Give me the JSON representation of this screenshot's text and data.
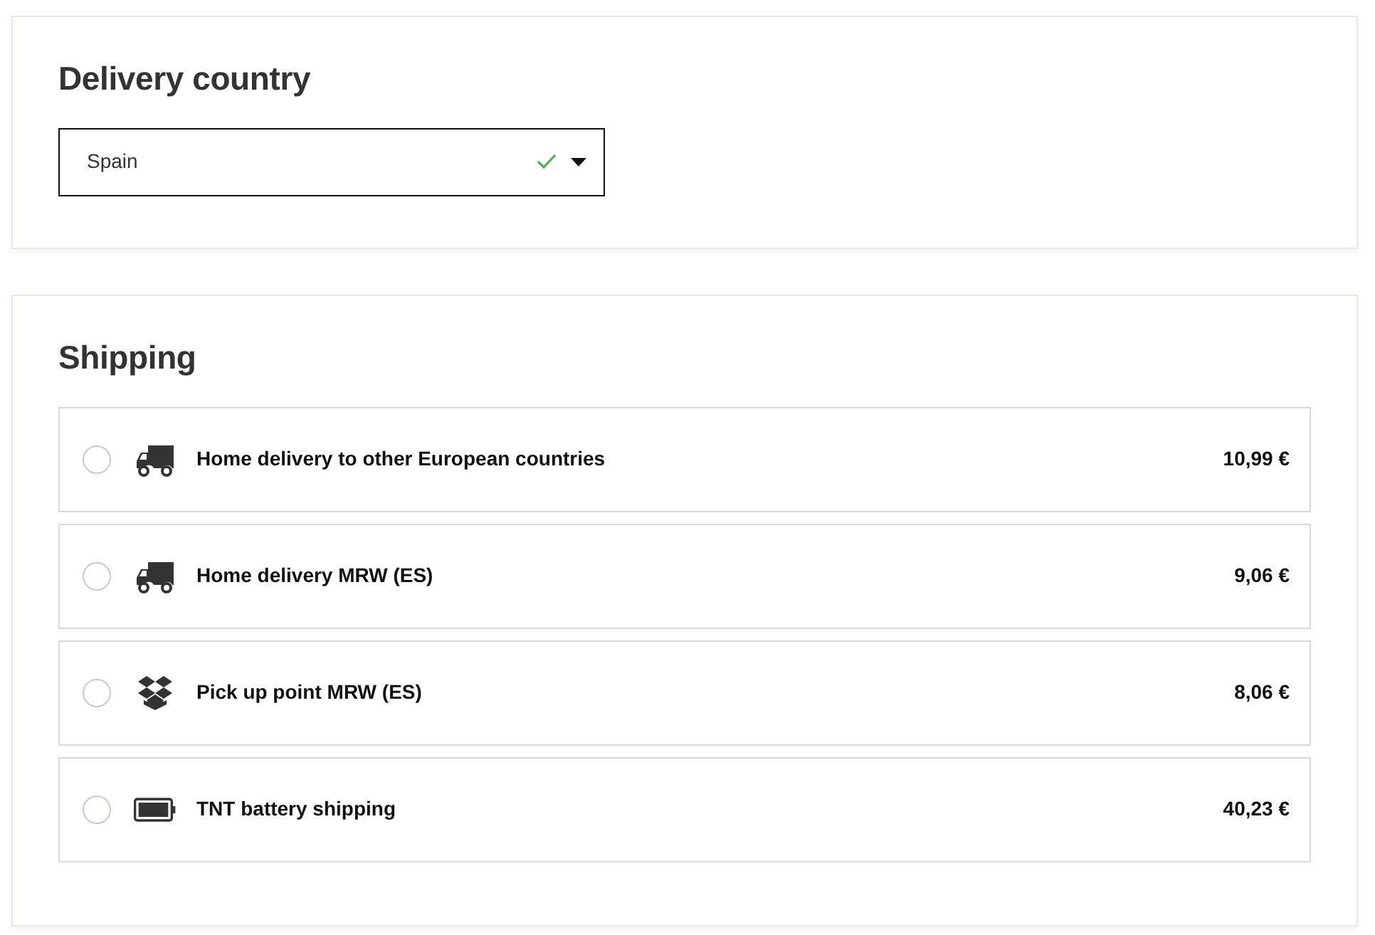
{
  "delivery_country": {
    "title": "Delivery country",
    "value": "Spain",
    "valid": true
  },
  "shipping": {
    "title": "Shipping",
    "options": [
      {
        "label": "Home delivery to other European countries",
        "price": "10,99 €",
        "kind": "truck",
        "selected": false
      },
      {
        "label": "Home delivery MRW (ES)",
        "price": "9,06 €",
        "kind": "truck",
        "selected": false
      },
      {
        "label": "Pick up point MRW (ES)",
        "price": "8,06 €",
        "kind": "boxes",
        "selected": false
      },
      {
        "label": "TNT battery shipping",
        "price": "40,23 €",
        "kind": "battery",
        "selected": false
      }
    ]
  }
}
